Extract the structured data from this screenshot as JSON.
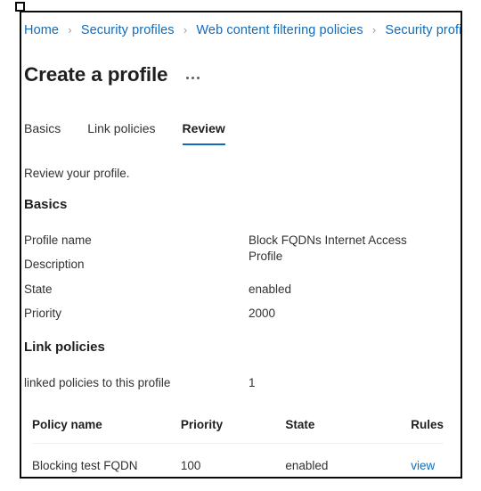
{
  "breadcrumb": {
    "separator": "›",
    "items": [
      {
        "label": "Home"
      },
      {
        "label": "Security profiles"
      },
      {
        "label": "Web content filtering policies"
      },
      {
        "label": "Security profiles"
      }
    ]
  },
  "header": {
    "title": "Create a profile",
    "more_actions_label": "···"
  },
  "tabs": [
    {
      "label": "Basics",
      "active": false
    },
    {
      "label": "Link policies",
      "active": false
    },
    {
      "label": "Review",
      "active": true
    }
  ],
  "main": {
    "intro": "Review your profile.",
    "basics": {
      "heading": "Basics",
      "rows": [
        {
          "key": "Profile name",
          "value": "Block FQDNs Internet Access Profile"
        },
        {
          "key": "Description",
          "value": ""
        },
        {
          "key": "State",
          "value": "enabled"
        },
        {
          "key": "Priority",
          "value": "2000"
        }
      ]
    },
    "link_policies": {
      "heading": "Link policies",
      "summary": {
        "key": "linked policies to this profile",
        "value": "1"
      },
      "table": {
        "columns": [
          "Policy name",
          "Priority",
          "State",
          "Rules"
        ],
        "rows": [
          {
            "policy_name": "Blocking test FQDN",
            "priority": "100",
            "state": "enabled",
            "rules": "view"
          }
        ]
      }
    }
  },
  "colors": {
    "link": "#0f6cbd",
    "accent": "#0f6cbd",
    "text": "#323130",
    "heading": "#201f1e",
    "separator": "#f0f0f0",
    "frame": "#0a0a0a"
  }
}
